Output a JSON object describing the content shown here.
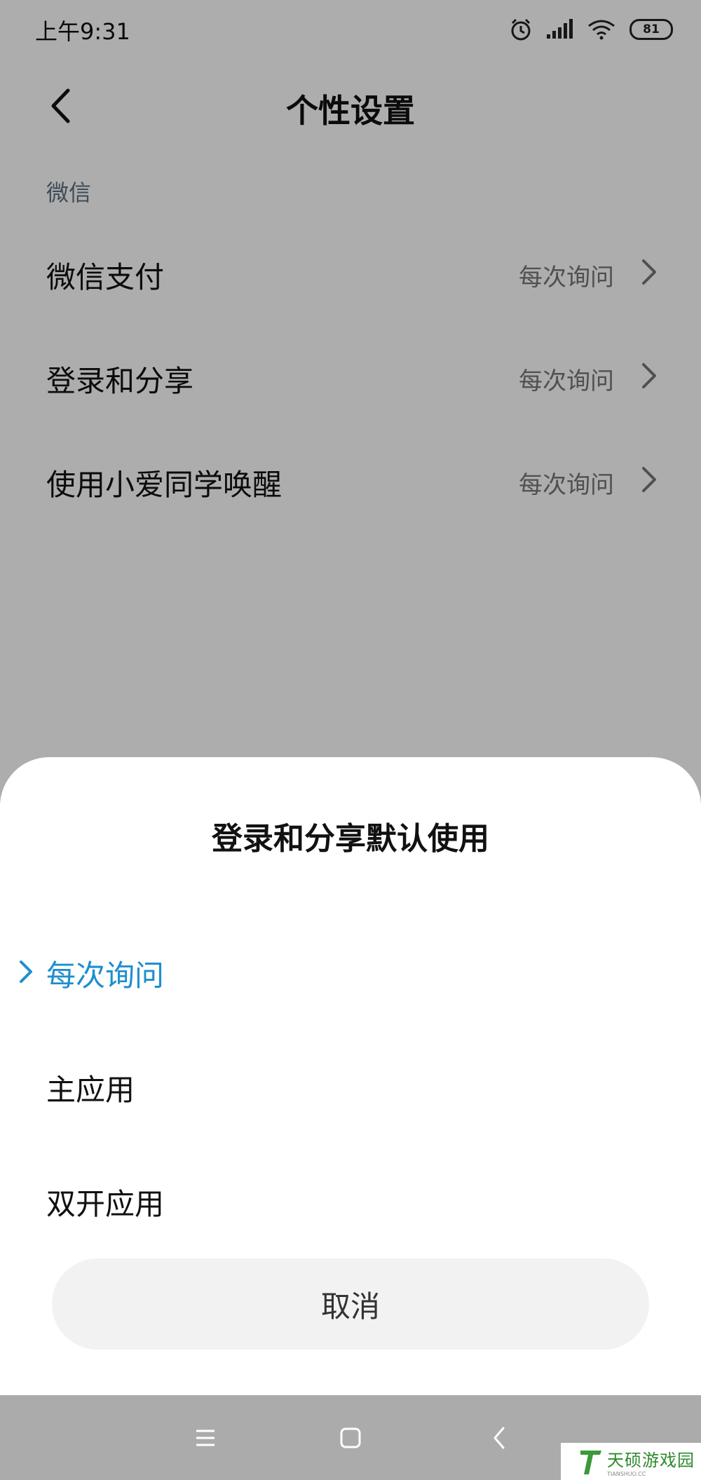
{
  "status_bar": {
    "time": "上午9:31",
    "battery": "81",
    "icons": [
      "alarm-icon",
      "signal-icon",
      "wifi-icon",
      "battery-icon"
    ]
  },
  "header": {
    "title": "个性设置"
  },
  "section": {
    "label": "微信"
  },
  "settings": [
    {
      "label": "微信支付",
      "value": "每次询问"
    },
    {
      "label": "登录和分享",
      "value": "每次询问"
    },
    {
      "label": "使用小爱同学唤醒",
      "value": "每次询问"
    }
  ],
  "sheet": {
    "title": "登录和分享默认使用",
    "options": [
      {
        "label": "每次询问",
        "selected": true
      },
      {
        "label": "主应用",
        "selected": false
      },
      {
        "label": "双开应用",
        "selected": false
      }
    ],
    "cancel_label": "取消"
  },
  "colors": {
    "accent": "#1e8fce",
    "overlay": "#ababab"
  },
  "watermark": {
    "text": "天硕游戏园",
    "subtext": "TIANSHUO.CC"
  }
}
